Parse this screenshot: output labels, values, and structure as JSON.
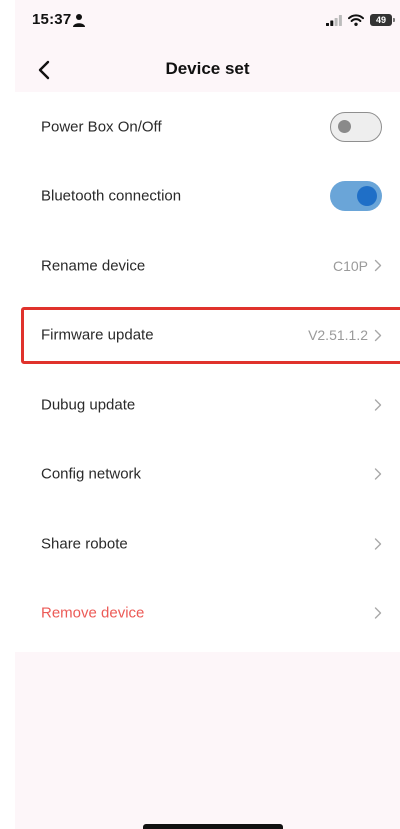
{
  "status_bar": {
    "time": "15:37",
    "battery": "49"
  },
  "header": {
    "title": "Device set"
  },
  "settings": {
    "power_box": {
      "label": "Power Box On/Off",
      "enabled": false
    },
    "bluetooth": {
      "label": "Bluetooth connection",
      "enabled": true
    },
    "rename": {
      "label": "Rename device",
      "value": "C10P"
    },
    "firmware": {
      "label": "Firmware update",
      "value": "V2.51.1.2"
    },
    "debug": {
      "label": "Dubug update"
    },
    "network": {
      "label": "Config network"
    },
    "share": {
      "label": "Share robote"
    },
    "remove": {
      "label": "Remove device"
    }
  },
  "colors": {
    "danger_text": "#ec5a56",
    "toggle_on_track": "#6aa5d8",
    "toggle_on_knob": "#1f6fc7",
    "highlight_border": "#e0322c",
    "background_tint": "#fdf6f9"
  },
  "icons": {
    "back": "chevron-left-icon",
    "row_arrow": "chevron-right-icon",
    "status": [
      "person-icon",
      "signal-icon",
      "wifi-icon",
      "battery-icon"
    ]
  }
}
